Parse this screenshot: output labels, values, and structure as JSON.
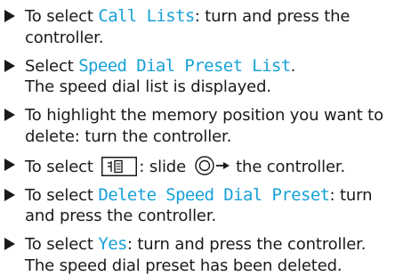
{
  "steps": [
    {
      "pre": "To select ",
      "display": "Call Lists",
      "post": ": turn and press the",
      "line2": "controller."
    },
    {
      "pre": "Select ",
      "display": "Speed Dial Preset List",
      "post": ".",
      "line2": "The speed dial list is displayed."
    },
    {
      "line1": "To highlight the memory position you want to",
      "line2": "delete: turn the controller."
    },
    {
      "pre": "To select ",
      "mid": ": slide ",
      "post": " the controller.",
      "icons": [
        "menu-icon",
        "slide-right-controller-icon"
      ]
    },
    {
      "pre": "To select ",
      "display": "Delete Speed Dial Preset",
      "post": ": turn",
      "line2": "and press the controller."
    },
    {
      "pre": "To select ",
      "display": "Yes",
      "post": ": turn and press the controller.",
      "line2": "The speed dial preset has been deleted."
    }
  ],
  "colors": {
    "text": "#1a1a1a",
    "display_text": "#17a1d8"
  }
}
